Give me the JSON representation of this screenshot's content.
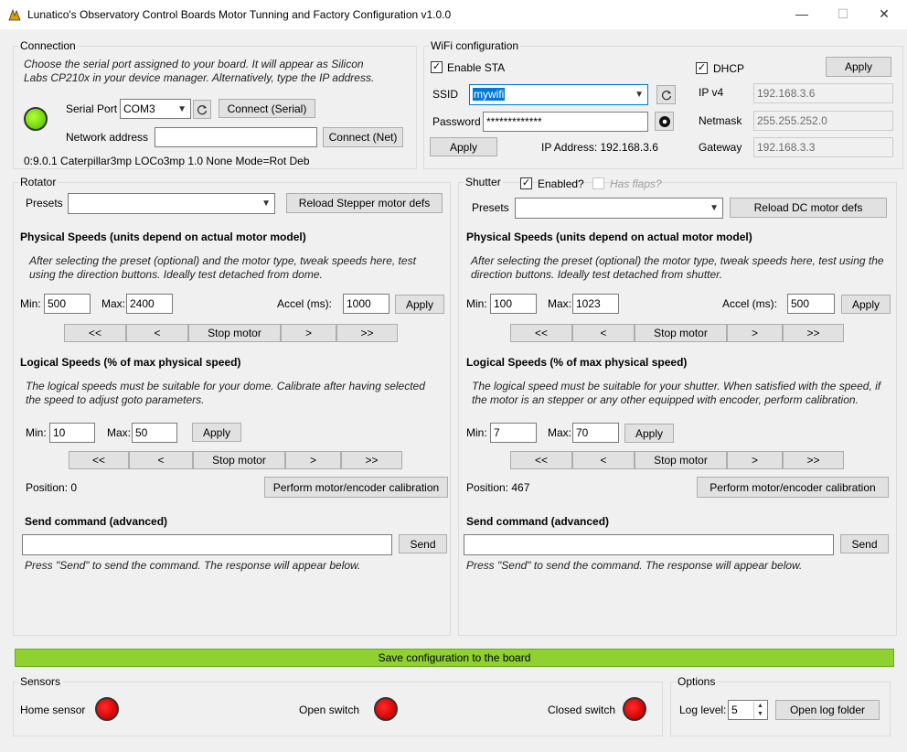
{
  "window": {
    "title": "Lunatico's Observatory Control Boards Motor Tunning and Factory Configuration v1.0.0",
    "minimize": "—",
    "maximize": "☐",
    "close": "✕"
  },
  "connection": {
    "legend": "Connection",
    "hint": "Choose the serial port assigned to your board. It will appear as Silicon Labs CP210x in your device manager. Alternatively, type the IP address.",
    "serial_port_label": "Serial Port",
    "serial_port_value": "COM3",
    "connect_serial": "Connect (Serial)",
    "network_address_label": "Network address",
    "network_address_value": "",
    "connect_net": "Connect (Net)",
    "status": "0:9.0.1 Caterpillar3mp LOCo3mp 1.0 None Mode=Rot Deb",
    "led_color": "#66d200"
  },
  "wifi": {
    "legend": "WiFi configuration",
    "enable_sta_label": "Enable STA",
    "enable_sta_checked": true,
    "dhcp_label": "DHCP",
    "dhcp_checked": true,
    "apply_top": "Apply",
    "ssid_label": "SSID",
    "ssid_value": "mywifi",
    "password_label": "Password",
    "password_value": "*************",
    "apply_bottom": "Apply",
    "ip_address_text": "IP Address: 192.168.3.6",
    "ipv4_label": "IP v4",
    "ipv4_value": "192.168.3.6",
    "netmask_label": "Netmask",
    "netmask_value": "255.255.252.0",
    "gateway_label": "Gateway",
    "gateway_value": "192.168.3.3"
  },
  "rotator": {
    "legend": "Rotator",
    "presets_label": "Presets",
    "presets_value": "",
    "reload_btn": "Reload Stepper motor defs",
    "physical_title": "Physical Speeds (units depend on actual motor model)",
    "physical_hint": "After selecting the preset (optional) and the motor type, tweak speeds here, test using the direction buttons. Ideally test detached from dome.",
    "min_label": "Min:",
    "min_value": "500",
    "max_label": "Max:",
    "max_value": "2400",
    "accel_label": "Accel (ms):",
    "accel_value": "1000",
    "apply_physical": "Apply",
    "nav": [
      "<<",
      "<",
      "Stop motor",
      ">",
      ">>"
    ],
    "logical_title": "Logical Speeds (% of max physical speed)",
    "logical_hint": "The logical speeds must be suitable for your dome. Calibrate after having selected the speed to adjust goto parameters.",
    "lmin_label": "Min:",
    "lmin_value": "10",
    "lmax_label": "Max:",
    "lmax_value": "50",
    "apply_logical": "Apply",
    "nav2": [
      "<<",
      "<",
      "Stop motor",
      ">",
      ">>"
    ],
    "position_text": "Position: 0",
    "calibrate_btn": "Perform motor/encoder calibration",
    "send_title": "Send command (advanced)",
    "send_value": "",
    "send_btn": "Send",
    "send_hint": "Press \"Send\" to send the command. The response will appear below."
  },
  "shutter": {
    "legend": "Shutter",
    "enabled_label": "Enabled?",
    "enabled_checked": true,
    "flaps_label": "Has flaps?",
    "flaps_checked": false,
    "presets_label": "Presets",
    "presets_value": "",
    "reload_btn": "Reload DC motor defs",
    "physical_title": "Physical Speeds (units depend on actual motor model)",
    "physical_hint": "After selecting the preset (optional) the motor type, tweak speeds here, test using the direction buttons. Ideally test detached from shutter.",
    "min_label": "Min:",
    "min_value": "100",
    "max_label": "Max:",
    "max_value": "1023",
    "accel_label": "Accel (ms):",
    "accel_value": "500",
    "apply_physical": "Apply",
    "nav": [
      "<<",
      "<",
      "Stop motor",
      ">",
      ">>"
    ],
    "logical_title": "Logical Speeds (% of max physical speed)",
    "logical_hint": "The logical speed must be suitable for your shutter. When satisfied with the speed, if the motor is an stepper or any other equipped with encoder, perform calibration.",
    "lmin_label": "Min:",
    "lmin_value": "7",
    "lmax_label": "Max:",
    "lmax_value": "70",
    "apply_logical": "Apply",
    "nav2": [
      "<<",
      "<",
      "Stop motor",
      ">",
      ">>"
    ],
    "position_text": "Position: 467",
    "calibrate_btn": "Perform motor/encoder calibration",
    "send_title": "Send command (advanced)",
    "send_value": "",
    "send_btn": "Send",
    "send_hint": "Press \"Send\" to send the command. The response will appear below."
  },
  "save_button": "Save configuration to the board",
  "sensors": {
    "legend": "Sensors",
    "home_label": "Home sensor",
    "open_label": "Open switch",
    "closed_label": "Closed switch",
    "led_color": "#d50000"
  },
  "options": {
    "legend": "Options",
    "log_level_label": "Log level:",
    "log_level_value": "5",
    "open_log_btn": "Open log folder"
  }
}
